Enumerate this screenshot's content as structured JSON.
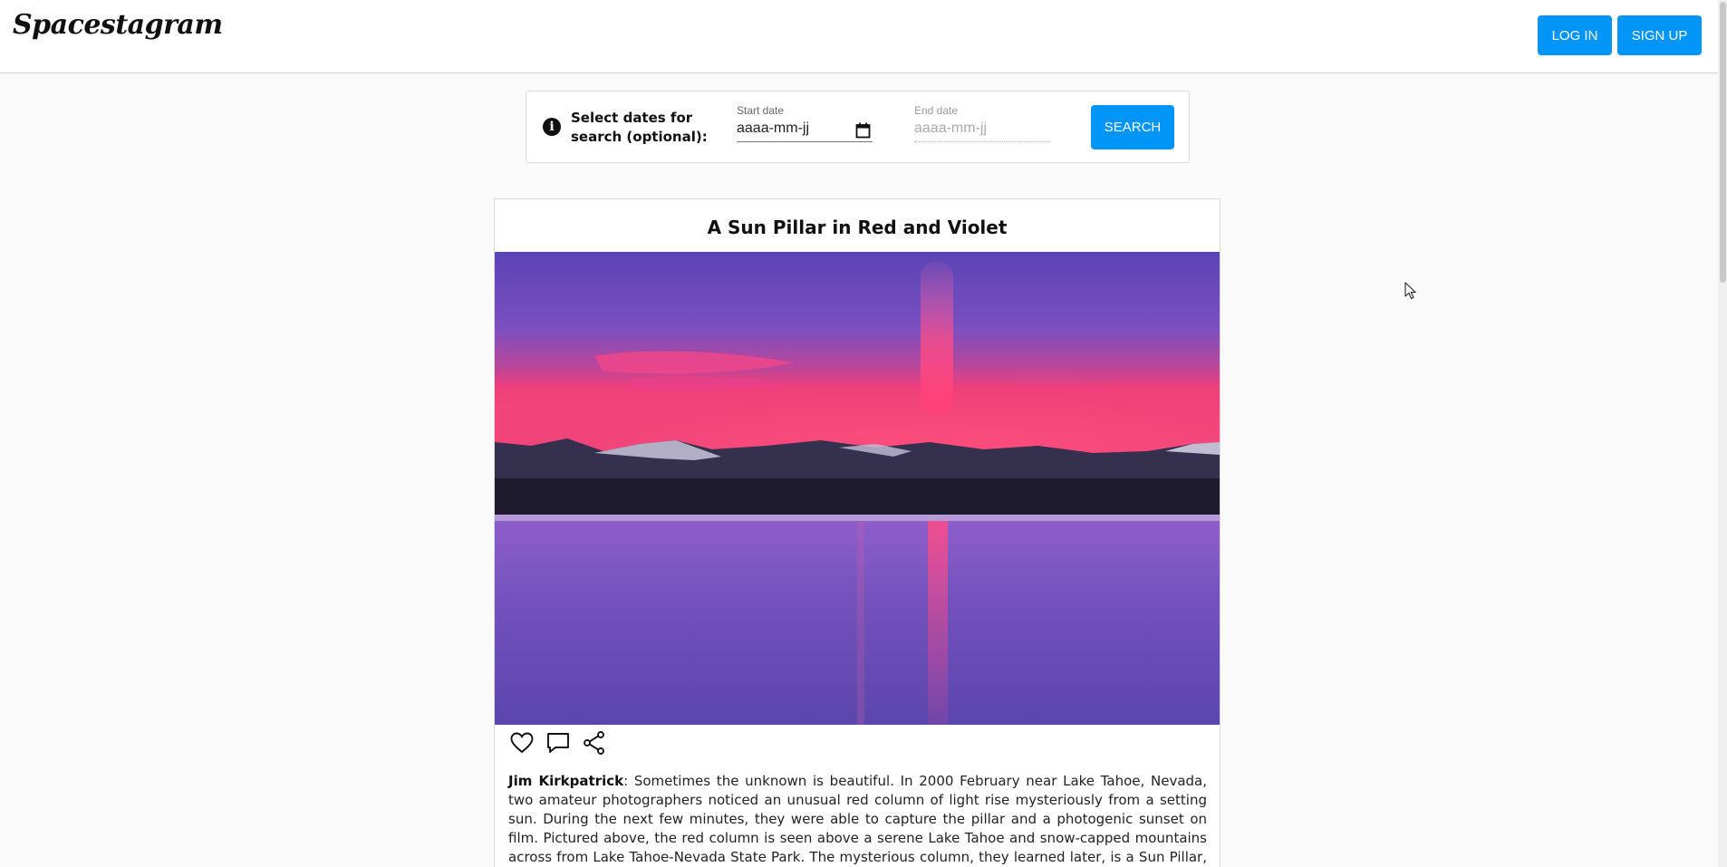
{
  "header": {
    "logo": "Spacestagram",
    "login_label": "LOG IN",
    "signup_label": "SIGN UP"
  },
  "search": {
    "prompt": "Select dates for search (optional):",
    "start": {
      "label": "Start date",
      "placeholder": "aaaa-mm-jj"
    },
    "end": {
      "label": "End date",
      "placeholder": "aaaa-mm-jj"
    },
    "button_label": "SEARCH"
  },
  "post": {
    "title": "A Sun Pillar in Red and Violet",
    "author": "Jim Kirkpatrick",
    "separator": ":",
    "text": " Sometimes the unknown is beautiful. In 2000 February near Lake Tahoe, Nevada, two amateur photographers noticed an unusual red column of light rise mysteriously from a setting sun. During the next few minutes, they were able to capture the pillar and a photogenic sunset on film. Pictured above, the red column is seen above a serene Lake Tahoe and snow-capped mountains across from Lake Tahoe-Nevada State Park. The mysterious column, they learned later, is a Sun Pillar, a phenomenon where sunlight"
  },
  "colors": {
    "accent": "#0095f6",
    "page_bg": "#fafafa"
  },
  "icons": [
    "info-icon",
    "calendar-icon",
    "heart-icon",
    "comment-icon",
    "share-icon"
  ]
}
